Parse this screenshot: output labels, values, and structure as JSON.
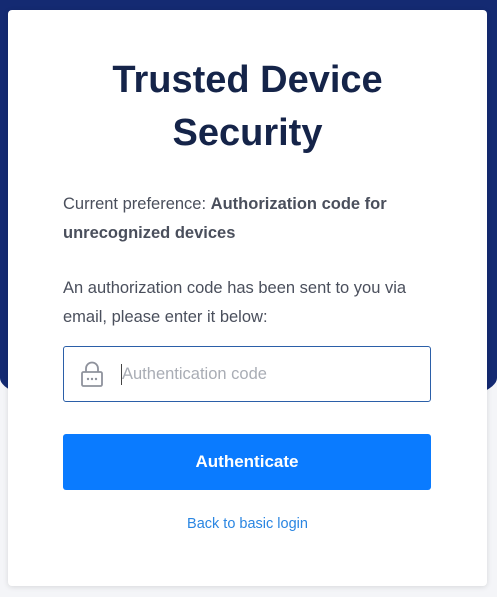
{
  "page": {
    "title_line1": "Trusted Device",
    "title_line2": "Security",
    "preference_label": "Current preference:",
    "preference_value": "Authorization code for unrecognized devices",
    "info_text": "An authorization code has been sent to you via email, please enter it below:"
  },
  "form": {
    "code_input": {
      "value": "",
      "placeholder": "Authentication code",
      "icon": "lock-icon"
    },
    "submit_label": "Authenticate",
    "back_link": "Back to basic login"
  },
  "colors": {
    "band": "#142a72",
    "title": "#152449",
    "button": "#0a7bff",
    "link": "#2a86e2",
    "input_border": "#2b5fa8"
  }
}
